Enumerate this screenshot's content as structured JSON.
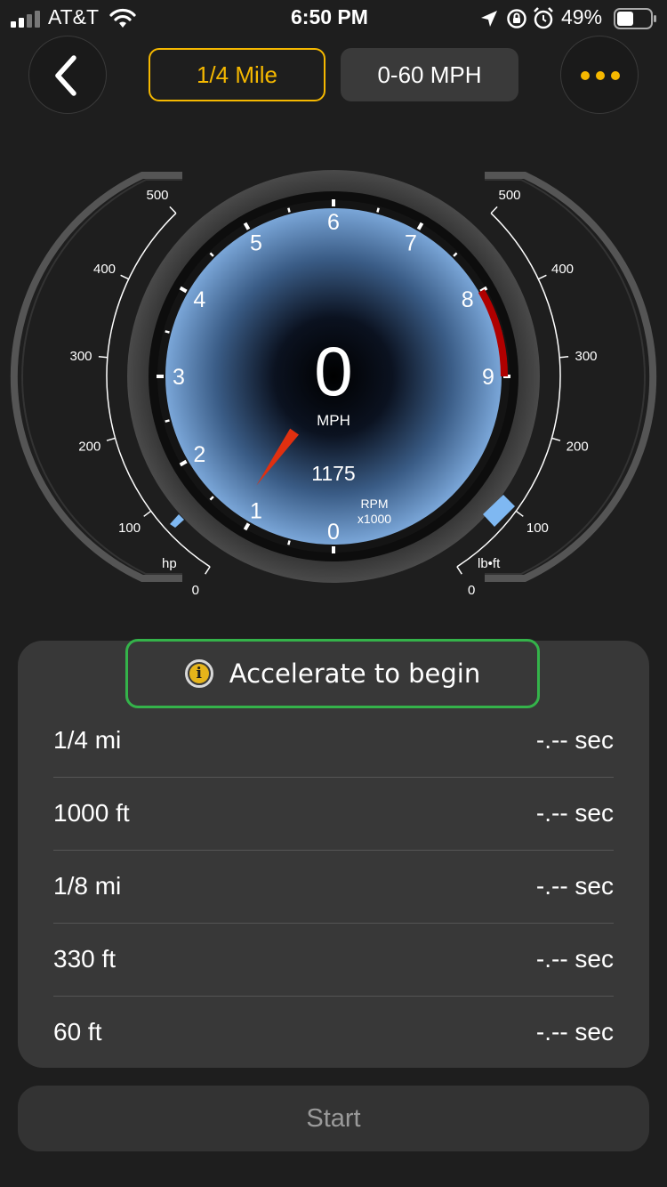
{
  "status_bar": {
    "carrier": "AT&T",
    "time": "6:50 PM",
    "battery": "49%"
  },
  "header": {
    "modes": [
      {
        "label": "1/4 Mile",
        "active": true
      },
      {
        "label": "0-60 MPH",
        "active": false
      }
    ]
  },
  "gauge": {
    "speed": "0",
    "speed_unit": "MPH",
    "rpm_value": "1175",
    "rpm_unit": "RPM",
    "rpm_multiplier": "x1000",
    "rpm_ticks": [
      "0",
      "1",
      "2",
      "3",
      "4",
      "5",
      "6",
      "7",
      "8",
      "9"
    ],
    "needle_rpm": 1.175,
    "redline_start_rpm": 8,
    "hp_label": "hp",
    "torque_label": "lb•ft",
    "side_ticks": [
      "0",
      "100",
      "200",
      "300",
      "400",
      "500"
    ],
    "hp_level": 0,
    "torque_level": 0
  },
  "status_message": "Accelerate to begin",
  "results": [
    {
      "label": "1/4 mi",
      "value": "-.-- sec"
    },
    {
      "label": "1000 ft",
      "value": "-.-- sec"
    },
    {
      "label": "1/8 mi",
      "value": "-.-- sec"
    },
    {
      "label": "330 ft",
      "value": "-.-- sec"
    },
    {
      "label": "60 ft",
      "value": "-.-- sec"
    }
  ],
  "start_label": "Start",
  "colors": {
    "accent": "#f5b800",
    "needle": "#e03010",
    "redline": "#b00000",
    "dial_blue": "#6f9fd4",
    "level_blue": "#7fb8f2",
    "success_border": "#34b34a"
  }
}
